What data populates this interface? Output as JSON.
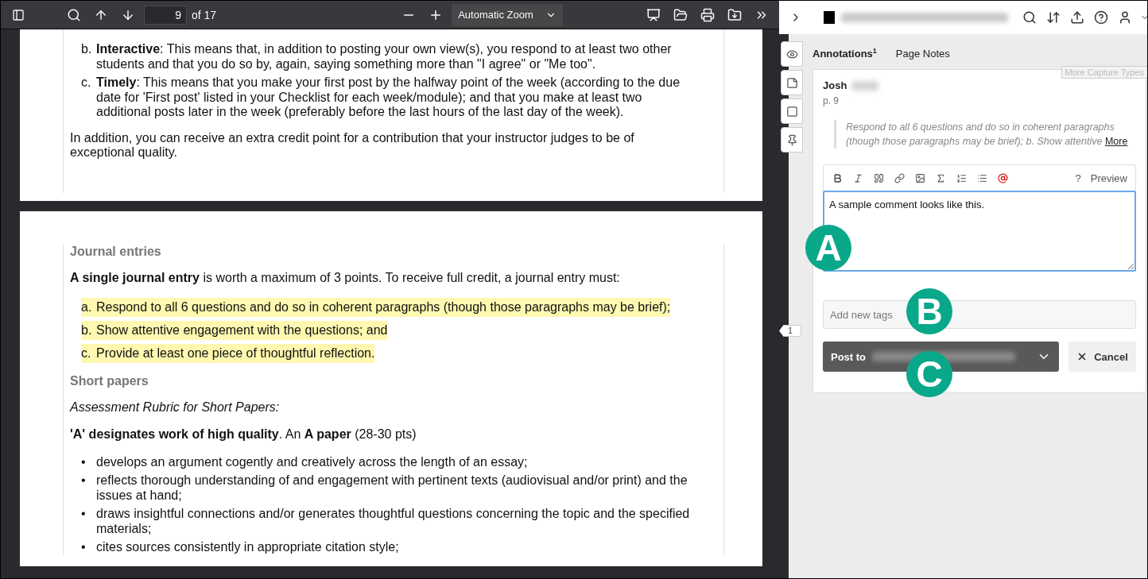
{
  "toolbar": {
    "page_number": "9",
    "page_count": "of 17",
    "zoom": "Automatic Zoom"
  },
  "document": {
    "pages": [
      {
        "blocks": [
          {
            "kind": "list",
            "items": [
              {
                "marker": "b.",
                "text": "**Interactive**: This means that, in addition to posting your own view(s), you respond to at least two other students and that you do so by, again, saying something more than \"I agree\" or \"Me too\".",
                "highlighted": false
              },
              {
                "marker": "c.",
                "text": "**Timely**: This means that you make your first post by the halfway point of the week (according to the due date for 'First post' listed in your Checklist for each week/module); and that you make at least two additional posts later in the week (preferably before the last hours of the last day of the week).",
                "highlighted": false
              }
            ]
          },
          {
            "kind": "paragraph",
            "text": "In addition, you can receive an extra credit point for a contribution that your instructor judges to be of exceptional quality."
          }
        ]
      },
      {
        "blocks": [
          {
            "kind": "heading",
            "text": "Journal entries"
          },
          {
            "kind": "paragraph",
            "text": "**A single journal entry** is worth a maximum of 3 points. To receive full credit, a journal entry must:"
          },
          {
            "kind": "list",
            "items": [
              {
                "marker": "a.",
                "text": "Respond to all 6 questions and do so in coherent paragraphs (though those paragraphs may be brief);",
                "highlighted": true
              },
              {
                "marker": "b.",
                "text": "Show attentive engagement with the questions; and",
                "highlighted": true
              },
              {
                "marker": "c.",
                "text": "Provide at least one piece of thoughtful reflection.",
                "highlighted": true
              }
            ]
          },
          {
            "kind": "heading",
            "text": "Short papers"
          },
          {
            "kind": "emphasis",
            "text": "Assessment Rubric for Short Papers:"
          },
          {
            "kind": "paragraph",
            "text": "**'A' designates work of high quality**. An **A paper** (28-30 pts)"
          },
          {
            "kind": "list",
            "items": [
              {
                "marker": "•",
                "text": "develops an argument cogently and creatively across the length of an essay;",
                "highlighted": false
              },
              {
                "marker": "•",
                "text": "reflects thorough understanding of and engagement with pertinent texts (audiovisual and/or print) and the issues at hand;",
                "highlighted": false
              },
              {
                "marker": "•",
                "text": "draws insightful connections and/or generates thoughtful questions concerning the topic and the specified materials;",
                "highlighted": false
              },
              {
                "marker": "•",
                "text": "cites sources consistently in appropriate citation style;",
                "highlighted": false
              }
            ]
          }
        ]
      }
    ]
  },
  "sidebar": {
    "tabs": [
      {
        "label": "Annotations",
        "count": "1",
        "selected": true
      },
      {
        "label": "Page Notes",
        "selected": false
      }
    ],
    "tooltip": "More Capture Types",
    "bucket_count": "1",
    "annotation": {
      "author": "Josh",
      "page": "p. 9",
      "quote": "Respond to all 6 questions and do so in coherent paragraphs (though those paragraphs may be brief); b. Show attentive",
      "more": "More",
      "editor": {
        "help": "?",
        "preview": "Preview",
        "comment": "A sample comment looks like this.",
        "tags_placeholder": "Add new tags",
        "post": "Post to",
        "cancel": "Cancel"
      }
    }
  },
  "callouts": [
    {
      "letter": "A"
    },
    {
      "letter": "B"
    },
    {
      "letter": "C"
    }
  ]
}
